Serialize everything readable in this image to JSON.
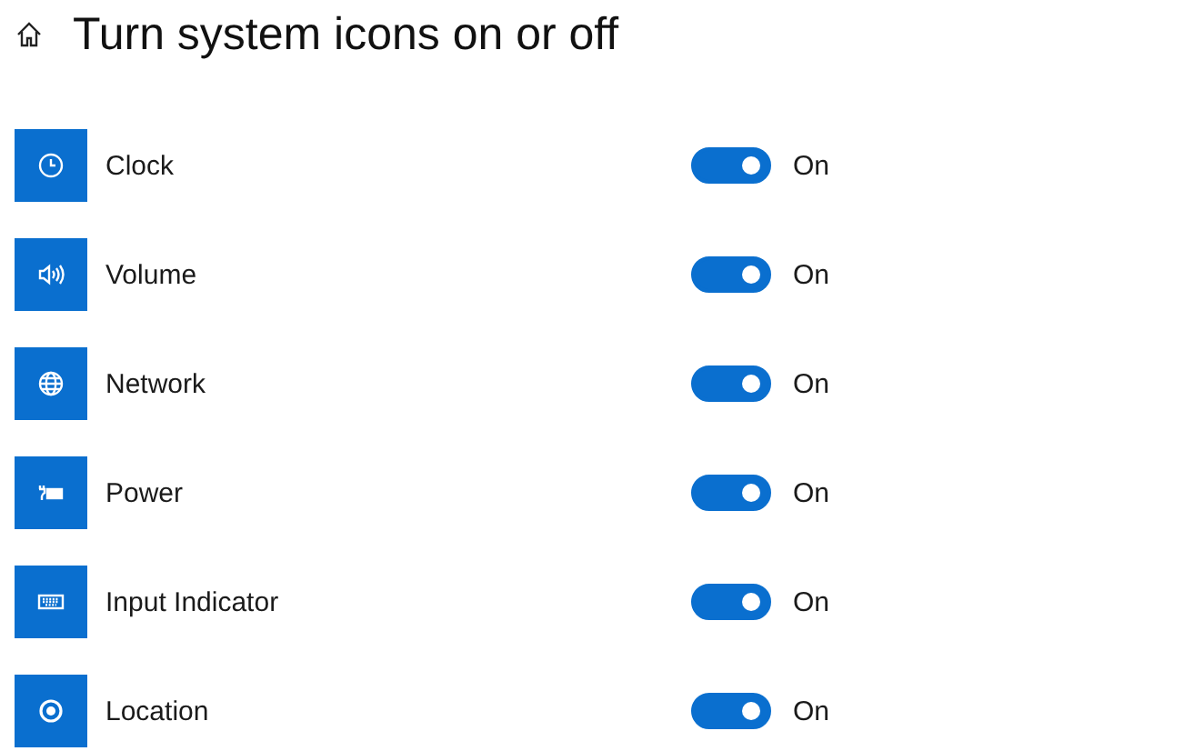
{
  "title": "Turn system icons on or off",
  "items": [
    {
      "label": "Clock",
      "on": true,
      "state_text": "On"
    },
    {
      "label": "Volume",
      "on": true,
      "state_text": "On"
    },
    {
      "label": "Network",
      "on": true,
      "state_text": "On"
    },
    {
      "label": "Power",
      "on": true,
      "state_text": "On"
    },
    {
      "label": "Input Indicator",
      "on": true,
      "state_text": "On"
    },
    {
      "label": "Location",
      "on": true,
      "state_text": "On"
    }
  ]
}
